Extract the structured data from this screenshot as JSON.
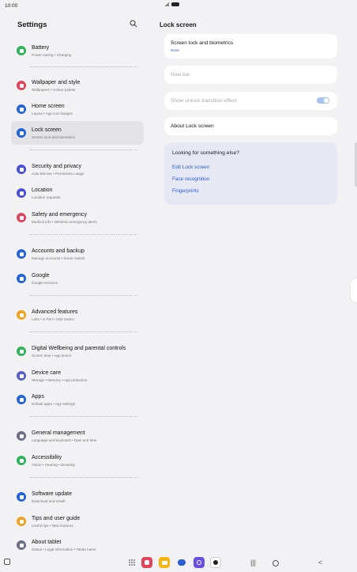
{
  "status": {
    "time": "10:00"
  },
  "left_panel": {
    "title": "Settings",
    "items": [
      {
        "label": "Battery",
        "sub": "Power saving • Charging",
        "color": "#2fb35a",
        "icon": "battery-icon"
      },
      {
        "label": "Wallpaper and style",
        "sub": "Wallpapers • Colour palette",
        "color": "#e0445c",
        "icon": "wallpaper-icon"
      },
      {
        "label": "Home screen",
        "sub": "Layout • App icon badges",
        "color": "#2563d9",
        "icon": "home-icon"
      },
      {
        "label": "Lock screen",
        "sub": "Screen lock and biometrics",
        "color": "#2563d9",
        "icon": "lock-icon"
      },
      {
        "label": "Security and privacy",
        "sub": "Auto Blocker • Permission usage",
        "color": "#4b4fd8",
        "icon": "shield-icon"
      },
      {
        "label": "Location",
        "sub": "Location requests",
        "color": "#4b4fd8",
        "icon": "location-pin-icon"
      },
      {
        "label": "Safety and emergency",
        "sub": "Medical info • Wireless emergency alerts",
        "color": "#e0445c",
        "icon": "emergency-icon"
      },
      {
        "label": "Accounts and backup",
        "sub": "Manage accounts • Smart Switch",
        "color": "#2563d9",
        "icon": "sync-icon"
      },
      {
        "label": "Google",
        "sub": "Google services",
        "color": "#2563d9",
        "icon": "google-icon"
      },
      {
        "label": "Advanced features",
        "sub": "Labs • S Pen • Side button",
        "color": "#f0a21f",
        "icon": "star-gear-icon"
      },
      {
        "label": "Digital Wellbeing and parental controls",
        "sub": "Screen time • App timers",
        "color": "#2fb35a",
        "icon": "wellbeing-icon"
      },
      {
        "label": "Device care",
        "sub": "Storage • Memory • App protection",
        "color": "#5a5fc8",
        "icon": "device-care-icon"
      },
      {
        "label": "Apps",
        "sub": "Default apps • App settings",
        "color": "#2563d9",
        "icon": "apps-icon"
      },
      {
        "label": "General management",
        "sub": "Language and keyboard • Date and time",
        "color": "#6b6f86",
        "icon": "sliders-icon"
      },
      {
        "label": "Accessibility",
        "sub": "Vision • Hearing • Dexterity",
        "color": "#2fb35a",
        "icon": "accessibility-icon"
      },
      {
        "label": "Software update",
        "sub": "Download and install",
        "color": "#2563d9",
        "icon": "update-icon"
      },
      {
        "label": "Tips and user guide",
        "sub": "Useful tips • New features",
        "color": "#f0a21f",
        "icon": "bulb-icon"
      },
      {
        "label": "About tablet",
        "sub": "Status • Legal information • Tablet name",
        "color": "#6b6f86",
        "icon": "info-icon"
      }
    ]
  },
  "right_panel": {
    "title": "Lock screen",
    "screen_lock": {
      "label": "Screen lock and biometrics",
      "value": "None"
    },
    "now_bar": {
      "label": "Now bar"
    },
    "unlock_effect": {
      "label": "Show unlock transition effect",
      "enabled": true
    },
    "about": {
      "label": "About Lock screen"
    },
    "looking": {
      "question": "Looking for something else?",
      "links": [
        "Edit Lock screen",
        "Face recognition",
        "Fingerprints"
      ]
    }
  },
  "colors": {
    "accent": "#2b5bd7",
    "background": "#f2f2f4"
  }
}
